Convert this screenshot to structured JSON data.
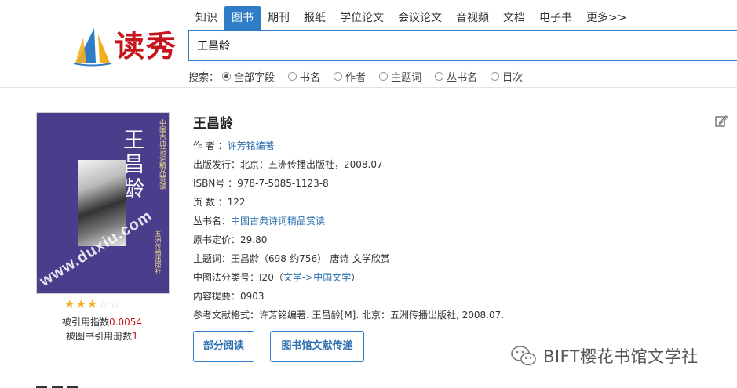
{
  "header": {
    "logo_text": "读秀",
    "tabs": [
      "知识",
      "图书",
      "期刊",
      "报纸",
      "学位论文",
      "会议论文",
      "音视频",
      "文档",
      "电子书",
      "更多>>"
    ],
    "active_tab_index": 1,
    "search_value": "王昌龄",
    "search_options_label": "搜索：",
    "search_options": [
      "全部字段",
      "书名",
      "作者",
      "主题词",
      "丛书名",
      "目次"
    ],
    "selected_option_index": 0
  },
  "cover": {
    "title": "王昌龄",
    "side_text": "中国古典诗词精品赏读",
    "publisher_text": "五洲传播出版社",
    "watermark": "www.duxiu.com"
  },
  "rating": {
    "stars_filled": 3,
    "stars_total": 5
  },
  "citation": {
    "index_label": "被引用指数",
    "index_value": "0.0054",
    "books_label": "被图书引用册数",
    "books_value": "1"
  },
  "book": {
    "title": "王昌龄",
    "author_label": "作 者 ：",
    "author": "许芳铭编著",
    "publish_label": "出版发行：",
    "publish": "北京：五洲传播出版社，2008.07",
    "isbn_label": "ISBN号 ：",
    "isbn": "978-7-5085-1123-8",
    "pages_label": "页 数 ：",
    "pages": "122",
    "series_label": "丛书名：",
    "series": "中国古典诗词精品赏读",
    "price_label": "原书定价：",
    "price": "29.80",
    "subject_label": "主题词：",
    "subject": "王昌龄（698-约756）-唐诗-文学欣赏",
    "clc_label": "中图法分类号：",
    "clc_code": "I20（",
    "clc_link": "文学->中国文学",
    "clc_end": "）",
    "summary_label": "内容提要：",
    "summary": "0903",
    "ref_label": "参考文献格式：",
    "ref": "许芳铭编著. 王昌龄[M]. 北京：五洲传播出版社, 2008.07."
  },
  "buttons": {
    "partial_read": "部分阅读",
    "library_delivery": "图书馆文献传递"
  },
  "wechat_watermark": "BIFT樱花书馆文学社",
  "colors": {
    "accent": "#2e7dc6",
    "link": "#2e6fb0",
    "red": "#c4161c",
    "star": "#f2b01e"
  }
}
